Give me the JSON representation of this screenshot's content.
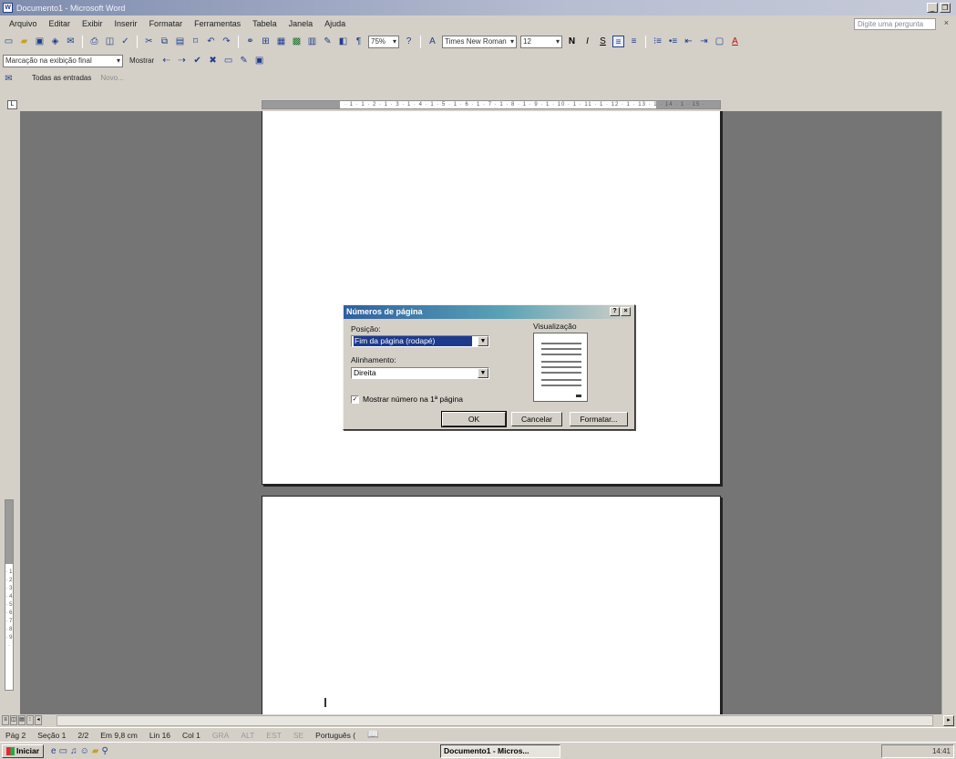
{
  "window": {
    "title": "Documento1 - Microsoft Word",
    "icon": "word-icon"
  },
  "menu": [
    "Arquivo",
    "Editar",
    "Exibir",
    "Inserir",
    "Formatar",
    "Ferramentas",
    "Tabela",
    "Janela",
    "Ajuda"
  ],
  "help_box": "Digite uma pergunta",
  "toolbar_standard": {
    "zoom": "75%",
    "icons": [
      "new-icon",
      "open-icon",
      "save-icon",
      "permission-icon",
      "email-icon",
      "print-icon",
      "print-preview-icon",
      "spelling-icon",
      "cut-icon",
      "copy-icon",
      "paste-icon",
      "format-painter-icon",
      "undo-icon",
      "redo-icon",
      "hyperlink-icon",
      "tables-icon",
      "insert-table-icon",
      "excel-icon",
      "columns-icon",
      "drawing-icon",
      "document-map-icon",
      "show-hide-icon",
      "help-icon"
    ]
  },
  "toolbar_formatting": {
    "font": "Times New Roman",
    "size": "12",
    "bold": "N",
    "italic": "I",
    "underline": "S"
  },
  "toolbar_review": {
    "display_combo": "Marcação na exibição final",
    "show_label": "Mostrar"
  },
  "toolbar_mail": {
    "all_entries": "Todas as entradas",
    "new_label": "Novo..."
  },
  "ruler": {
    "text": "· 1 · 1 · 2 · 1 · 3 · 1 · 4 · 1 · 5 · 1 · 6 · 1 · 7 · 1 · 8 · 1 · 9 · 1 · 10 · 1 · 11 · 1 · 12 · 1 · 13 · 1 · 14 · 1 · 15 ·"
  },
  "vruler": {
    "text": "· 1 · 2 · 3 · 4 · 5 · 6 · 7 · 8 · 9 ·"
  },
  "dialog": {
    "title": "Números de página",
    "position_label": "Posição:",
    "position_value": "Fim da página (rodapé)",
    "alignment_label": "Alinhamento:",
    "alignment_value": "Direita",
    "preview_label": "Visualização",
    "show_first_page": "Mostrar número na 1ª página",
    "show_first_page_checked": true,
    "ok": "OK",
    "cancel": "Cancelar",
    "format": "Formatar..."
  },
  "status": {
    "page": "Pág 2",
    "section": "Seção 1",
    "pages": "2/2",
    "at": "Em 9,8 cm",
    "line": "Lin 16",
    "col": "Col 1",
    "gra": "GRA",
    "alt": "ALT",
    "est": "EST",
    "se": "SE",
    "language": "Português (",
    "spell_icon": "spelling-status-icon"
  },
  "taskbar": {
    "start": "Iniciar",
    "task": "Documento1 - Micros...",
    "clock": "14:41"
  }
}
